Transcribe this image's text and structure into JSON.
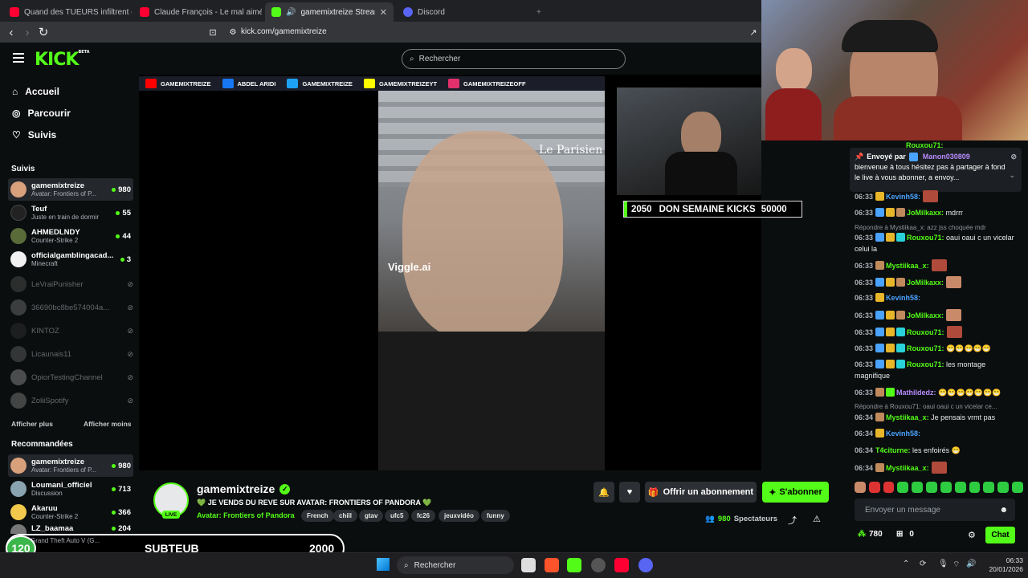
{
  "browser": {
    "tabs": [
      {
        "title": "Quand des TUEURS infiltrent des JEU",
        "fav": "#ff0033"
      },
      {
        "title": "Claude François - Le mal aimé (Offic",
        "fav": "#ff0033"
      },
      {
        "title": "gamemixtreize Stream - Watc",
        "fav": "#53fc18"
      },
      {
        "title": "Discord",
        "fav": "#5865f2"
      }
    ],
    "url": "kick.com/gamemixtreize"
  },
  "header": {
    "logo": "KICK",
    "logo_beta": "BETA",
    "search_placeholder": "Rechercher"
  },
  "nav": {
    "home": "Accueil",
    "browse": "Parcourir",
    "following": "Suivis"
  },
  "sidebar": {
    "followed_title": "Suivis",
    "followed": [
      {
        "name": "gamemixtreize",
        "sub": "Avatar: Frontiers of P...",
        "count": "980",
        "color": "#d9a07c"
      },
      {
        "name": "Teuf",
        "sub": "Juste en train de dormir",
        "count": "55",
        "color": "#222"
      },
      {
        "name": "AHMEDLNDY",
        "sub": "Counter-Strike 2",
        "count": "44",
        "color": "#5a6b3a"
      },
      {
        "name": "officialgamblingacad...",
        "sub": "Minecraft",
        "count": "3",
        "color": "#f1f1f1"
      }
    ],
    "offline": [
      "LeVraiPunisher",
      "36690bc8be574004a...",
      "KINTOZ",
      "Licaunais11",
      "OpiorTestingChannel",
      "ZoliiSpotify"
    ],
    "show_more": "Afficher plus",
    "show_less": "Afficher moins",
    "recommended_title": "Recommandées",
    "recommended": [
      {
        "name": "gamemixtreize",
        "sub": "Avatar: Frontiers of P...",
        "count": "980",
        "color": "#d9a07c"
      },
      {
        "name": "Loumani_officiel",
        "sub": "Discussion",
        "count": "713",
        "color": "#8aa3b0"
      },
      {
        "name": "Akaruu",
        "sub": "Counter-Strike 2",
        "count": "366",
        "color": "#f2c94c"
      },
      {
        "name": "LZ_baamaa",
        "sub": "",
        "count": "204",
        "color": "#777"
      }
    ]
  },
  "video": {
    "socials": [
      {
        "label": "GAMEMIXTREIZE",
        "color": "#ff0000"
      },
      {
        "label": "ABDEL ARIDI",
        "color": "#1877f2"
      },
      {
        "label": "GAMEMIXTREIZE",
        "color": "#1da1f2"
      },
      {
        "label": "GAMEMIXTREIZEYT",
        "color": "#fffc00"
      },
      {
        "label": "GAMEMIXTREIZEOFF",
        "color": "#e1306c"
      }
    ],
    "watermark1": "Le Parisien",
    "watermark2": "Viggle.ai",
    "donation_count": "2050",
    "donation_label": "DON SEMAINE KICKS",
    "donation_goal": "50000"
  },
  "stream": {
    "name": "gamemixtreize",
    "title": "💚 JE VENDS DU REVE SUR AVATAR: FRONTIERS OF PANDORA 💚",
    "category": "Avatar: Frontiers of Pandora",
    "tags": [
      "French",
      "chill",
      "gtav",
      "ufc5",
      "fc26",
      "jeuxvidéo",
      "funny"
    ],
    "live": "LIVE",
    "gift": "Offrir un abonnement",
    "subscribe": "S'abonner",
    "viewers": "980",
    "viewers_label": "Spectateurs"
  },
  "overlay": {
    "level": "120",
    "label": "SUBTEUB",
    "value": "2000",
    "game": "Grand Theft Auto V (G..."
  },
  "chat": {
    "pinned_by": "Envoyé par",
    "pinned_user": "Manon030809",
    "pinned_text": "bienvenue à tous hésitez pas à partager à fond le live à vous abonner, a envoy...",
    "top_user": "Rouxou71:",
    "messages": [
      {
        "time": "06:33",
        "user": "Kevinh58:",
        "color": "#4aa3ff",
        "text": ""
      },
      {
        "time": "06:33",
        "user": "JoMilkaxx:",
        "color": "#53fc18",
        "text": " mdrrr"
      },
      {
        "time": "06:33",
        "user": "Rouxou71:",
        "color": "#53fc18",
        "text": " oaui oaui c un vicelar celui la"
      },
      {
        "time": "06:33",
        "user": "Mystiikaa_x:",
        "color": "#53fc18",
        "text": ""
      },
      {
        "time": "06:33",
        "user": "JoMilkaxx:",
        "color": "#53fc18",
        "text": ""
      },
      {
        "time": "06:33",
        "user": "Kevinh58:",
        "color": "#4aa3ff",
        "text": ""
      },
      {
        "time": "06:33",
        "user": "JoMilkaxx:",
        "color": "#53fc18",
        "text": ""
      },
      {
        "time": "06:33",
        "user": "Rouxou71:",
        "color": "#53fc18",
        "text": ""
      },
      {
        "time": "06:33",
        "user": "Rouxou71:",
        "color": "#53fc18",
        "text": " 😁😁😁😁😁"
      },
      {
        "time": "06:33",
        "user": "Rouxou71:",
        "color": "#53fc18",
        "text": " les montage magnifique"
      },
      {
        "time": "06:33",
        "user": "Mathildedz:",
        "color": "#b88cff",
        "text": " 😁😁😁😁😁😁😁"
      },
      {
        "time": "06:34",
        "user": "Mystiikaa_x:",
        "color": "#53fc18",
        "text": " Je pensais vrmt pas"
      },
      {
        "time": "06:34",
        "user": "Kevinh58:",
        "color": "#4aa3ff",
        "text": ""
      },
      {
        "time": "06:34",
        "user": "T4citurne:",
        "color": "#53fc18",
        "text": " les enfoirés 😁"
      },
      {
        "time": "06:34",
        "user": "Mystiikaa_x:",
        "color": "#53fc18",
        "text": ""
      }
    ],
    "reply1": "Répondre à Mystiikaa_x: azz jss choquée mdr",
    "reply2": "Répondre à Rouxou71: oaui oaui c un vicelar ce...",
    "input_placeholder": "Envoyer un message",
    "points": "780",
    "gifts": "0",
    "send": "Chat"
  },
  "taskbar": {
    "search": "Rechercher",
    "time": "06:33",
    "date": "20/01/2026"
  }
}
